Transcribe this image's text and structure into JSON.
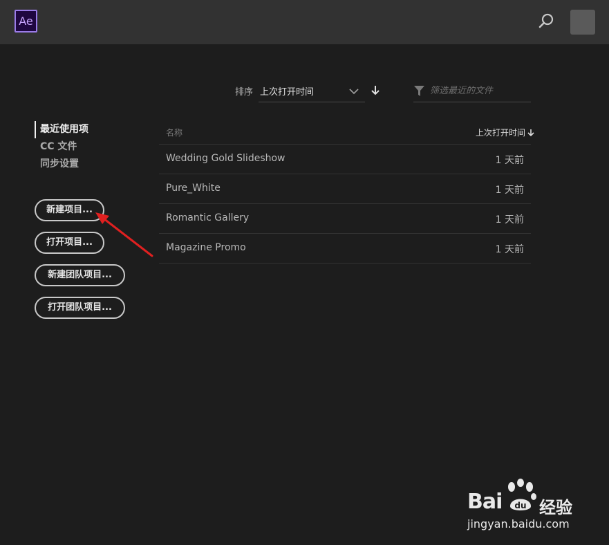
{
  "app": {
    "logo_text": "Ae",
    "accent": "#9a7be8"
  },
  "header": {
    "search_icon": "search-icon",
    "avatar": "user-avatar"
  },
  "sort": {
    "label": "排序",
    "selected": "上次打开时间",
    "direction": "descending"
  },
  "filter": {
    "placeholder": "筛选最近的文件",
    "value": ""
  },
  "nav": {
    "items": [
      {
        "label": "最近使用项",
        "active": true
      },
      {
        "label": "CC 文件",
        "active": false
      },
      {
        "label": "同步设置",
        "active": false
      }
    ]
  },
  "actions": {
    "new_project": "新建项目...",
    "open_project": "打开项目...",
    "new_team_project": "新建团队项目...",
    "open_team_project": "打开团队项目..."
  },
  "table": {
    "col_name": "名称",
    "col_date": "上次打开时间",
    "rows": [
      {
        "name": "Wedding Gold Slideshow",
        "date": "1 天前"
      },
      {
        "name": "Pure_White",
        "date": "1 天前"
      },
      {
        "name": "Romantic Gallery",
        "date": "1 天前"
      },
      {
        "name": "Magazine Promo",
        "date": "1 天前"
      }
    ]
  },
  "annotation": {
    "color": "#e02020"
  },
  "watermark": {
    "brand": "Bai",
    "brand_suffix": "经验",
    "url": "jingyan.baidu.com"
  }
}
